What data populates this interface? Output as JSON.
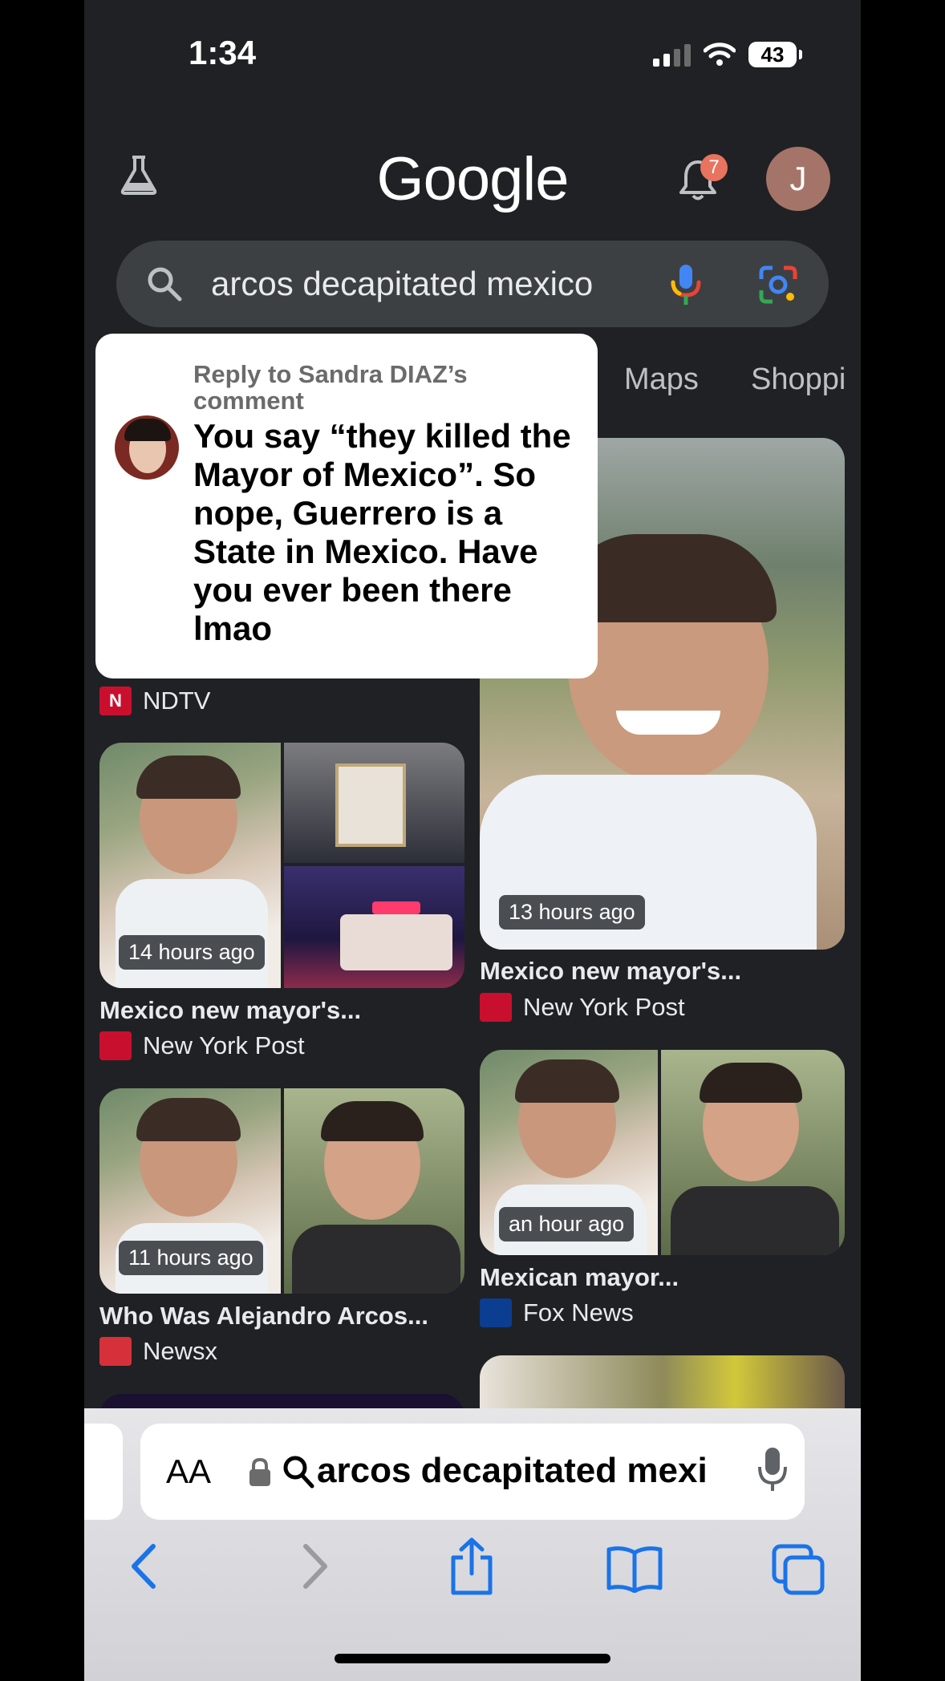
{
  "status": {
    "time": "1:34",
    "battery": "43"
  },
  "header": {
    "logo": "Google",
    "notification_count": "7",
    "account_initial": "J"
  },
  "search": {
    "query": "arcos decapitated mexico"
  },
  "tabs": [
    "Maps",
    "Shoppi"
  ],
  "popup": {
    "reply_to": "Reply to Sandra DIAZ’s comment",
    "body": "You say “they killed the Mayor of Mexico”. So nope, Guerrero is a State in Mexico. Have you ever been there lmao"
  },
  "results": [
    {
      "source": "NDTV"
    },
    {
      "time": "14 hours ago",
      "title": "Mexico new mayor's...",
      "source": "New York Post"
    },
    {
      "time": "11 hours ago",
      "title": "Who Was Alejandro Arcos...",
      "source": "Newsx"
    },
    {
      "time": "13 hours ago",
      "title": "Mexico new mayor's...",
      "source": "New York Post"
    },
    {
      "time": "an hour ago",
      "title": "Mexican mayor...",
      "source": "Fox News"
    }
  ],
  "safari": {
    "aa_label": "AA",
    "url_text": "arcos decapitated mexi"
  },
  "icons": {
    "flask": "flask-icon",
    "bell": "bell-icon",
    "search": "search-icon",
    "mic": "mic-icon",
    "lens": "lens-icon",
    "lock": "lock-icon",
    "back": "back-icon",
    "forward": "forward-icon",
    "share": "share-icon",
    "bookmarks": "bookmarks-icon",
    "tabs": "tabs-icon"
  },
  "colors": {
    "background": "#202124",
    "search_bar": "#3c4043",
    "badge": "#e8735e",
    "avatar": "#a57468",
    "safari_blue": "#1a73e8"
  }
}
